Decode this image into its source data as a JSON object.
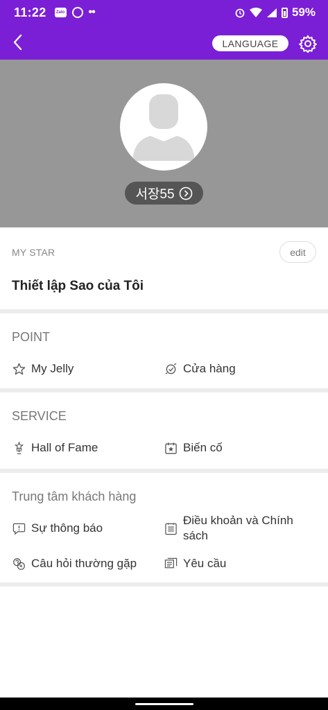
{
  "status_bar": {
    "time": "11:22",
    "battery": "59%",
    "app_icon_text": "Zalo"
  },
  "header": {
    "language_label": "LANGUAGE"
  },
  "profile": {
    "username": "서장55"
  },
  "my_star": {
    "label": "MY STAR",
    "edit_label": "edit",
    "value": "Thiết lập Sao của Tôi"
  },
  "point": {
    "title": "POINT",
    "items": [
      {
        "label": "My Jelly",
        "icon": "star-outline-icon"
      },
      {
        "label": "Cửa hàng",
        "icon": "shop-icon"
      }
    ]
  },
  "service": {
    "title": "SERVICE",
    "items": [
      {
        "label": "Hall of Fame",
        "icon": "trophy-icon"
      },
      {
        "label": "Biến cố",
        "icon": "calendar-star-icon"
      }
    ]
  },
  "customer_center": {
    "title": "Trung tâm khách hàng",
    "items": [
      {
        "label": "Sự thông báo",
        "icon": "chat-alert-icon"
      },
      {
        "label": "Điều khoản và Chính sách",
        "icon": "document-icon"
      },
      {
        "label": "Câu hỏi thường gặp",
        "icon": "faq-icon"
      },
      {
        "label": "Yêu cầu",
        "icon": "inquiry-icon"
      }
    ]
  },
  "colors": {
    "brand": "#7a1fd6",
    "profile_bg": "#979797",
    "name_pill": "#555555"
  }
}
